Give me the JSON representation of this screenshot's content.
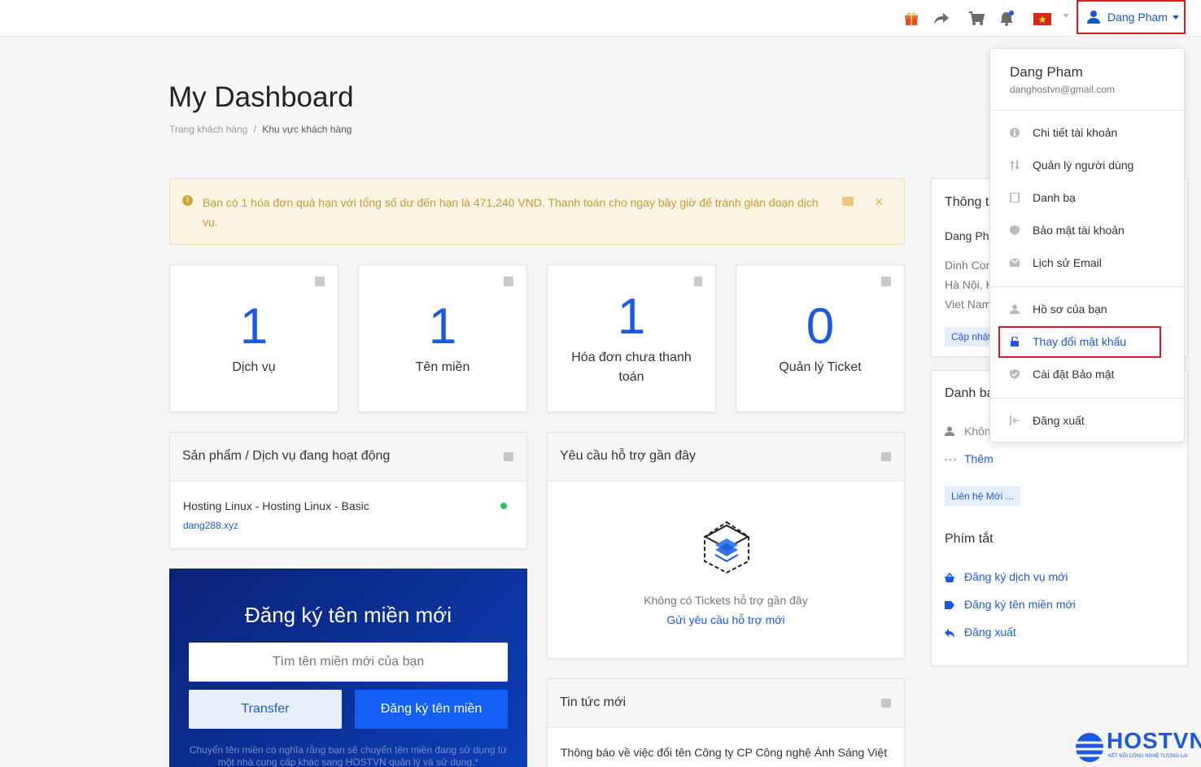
{
  "topbar": {
    "user_name": "Dang Pham",
    "icons": [
      "gift-icon",
      "share-icon",
      "cart-icon",
      "bell-icon",
      "flag-vn-icon"
    ]
  },
  "page": {
    "title": "My Dashboard",
    "breadcrumb": {
      "home": "Trang khách hàng",
      "separator": "/",
      "current": "Khu vực khách hàng"
    }
  },
  "alert": {
    "text": "Bạn có 1 hóa đơn quá hạn với tổng số dư đến hạn là 471,240 VND. Thanh toán cho ngay bây giờ để tránh gián đoạn dịch vụ.",
    "close": "×",
    "icon_glyph": "!"
  },
  "tiles": [
    {
      "value": "1",
      "label": "Dịch vụ"
    },
    {
      "value": "1",
      "label": "Tên miền"
    },
    {
      "value": "1",
      "label": "Hóa đơn chưa thanh toán"
    },
    {
      "value": "0",
      "label": "Quản lý Ticket"
    }
  ],
  "products_panel": {
    "title": "Sản phẩm / Dịch vụ đang hoạt động",
    "item_name": "Hosting Linux - Hosting Linux - Basic",
    "item_domain": "dang288.xyz",
    "status_color": "#28c15a"
  },
  "support_panel": {
    "title": "Yêu cầu hỗ trợ gần đây",
    "empty_text": "Không có Tickets hỗ trợ gần đây",
    "link": "Gửi yêu cầu hỗ trợ mới"
  },
  "news_panel": {
    "title": "Tin tức mới",
    "item": "Thông báo về việc đổi tên Công ty CP Công nghệ Ánh Sáng Việt"
  },
  "domain_box": {
    "title": "Đăng ký tên miền mới",
    "placeholder": "Tìm tên miền mới của bạn",
    "transfer": "Transfer",
    "register": "Đăng ký tên miền",
    "note": "Chuyển tên miền có nghĩa rằng bạn sẽ chuyển tên miền đang sử dụng từ một nhà cung cấp khác sang HOSTVN quản lý và sử dụng.*"
  },
  "sidebar": {
    "info_title": "Thông tin",
    "info_name": "Dang Pham",
    "address_1": "Dinh Cong",
    "address_2": "Hà Nội, H",
    "address_3": "Viet Nam",
    "update_btn": "Cập nhật",
    "contacts_title": "Danh bạ",
    "no_contacts": "Không",
    "more": "Thêm",
    "new_contact_btn": "Liên hệ Mới ...",
    "shortcuts_title": "Phím tắt",
    "shortcuts": [
      "Đăng ký dịch vụ mới",
      "Đăng ký tên miền mới",
      "Đăng xuất"
    ]
  },
  "dropdown": {
    "name": "Dang Pham",
    "email": "danghostvn@gmail.com",
    "group1": [
      "Chi tiết tài khoản",
      "Quản lý người dùng",
      "Danh bạ",
      "Bảo mật tài khoản",
      "Lịch sử Email"
    ],
    "group2": [
      "Hồ sơ của bạn",
      "Thay đổi mật khẩu",
      "Cài đặt Bảo mật"
    ],
    "logout": "Đăng xuất"
  },
  "logo": {
    "brand": "HOSTVN",
    "tagline": "KẾT NỐI CÔNG NGHỆ TƯƠNG LAI",
    "accent": "#1a59e3"
  }
}
